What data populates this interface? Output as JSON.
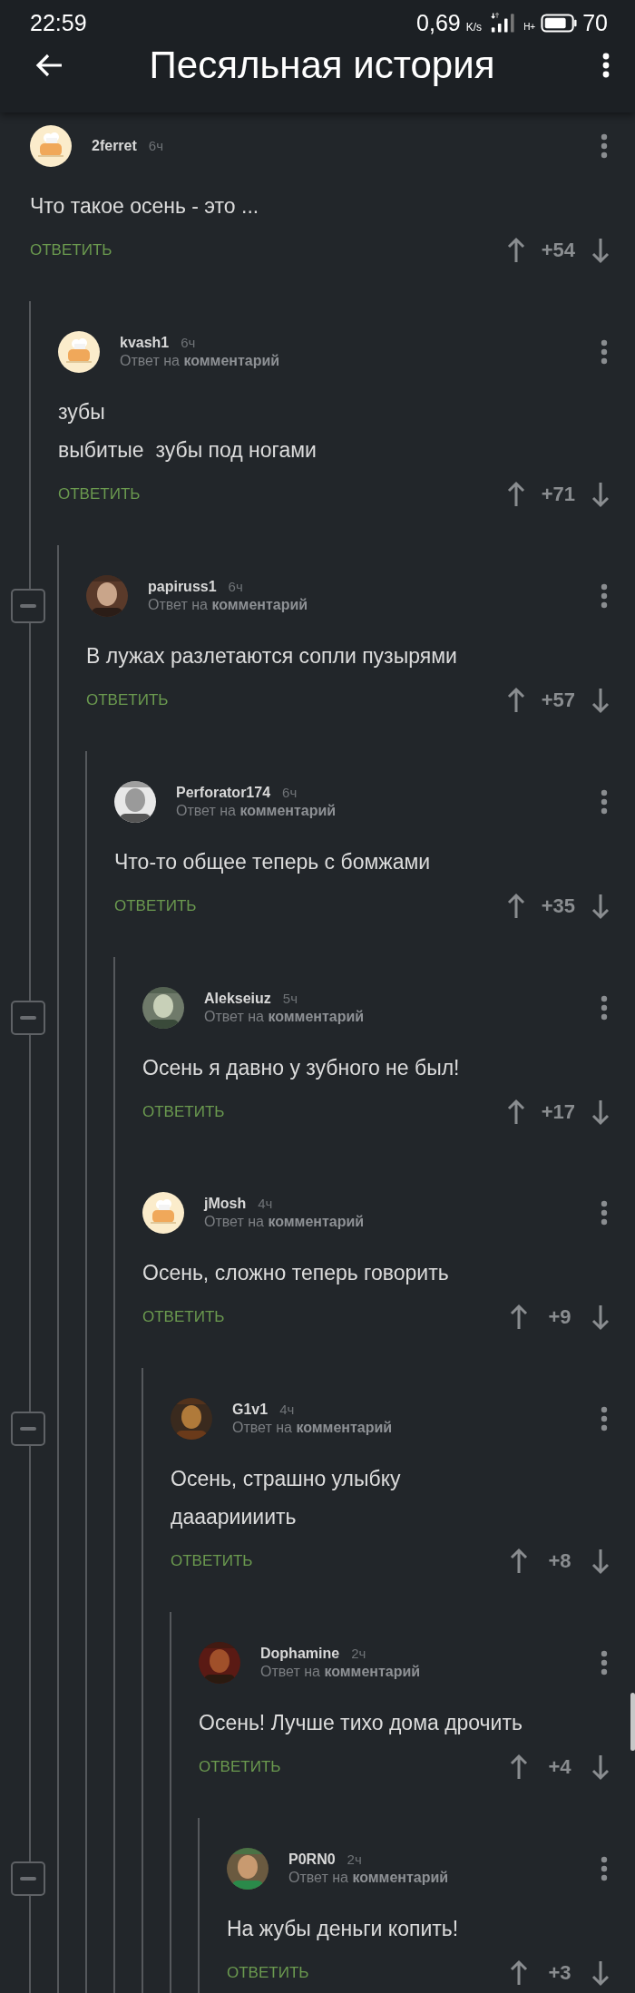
{
  "status_bar": {
    "time": "22:59",
    "speed": "0,69",
    "speed_unit": "K/s",
    "network": "H+",
    "battery": "70"
  },
  "app_bar": {
    "title": "Песяльная история"
  },
  "comments": [
    {
      "author": "2ferret",
      "time": "6ч",
      "avatar": {
        "kind": "default"
      },
      "text": "Что такое осень - это ...",
      "reply_label": "ОТВЕТИТЬ",
      "score": "+54",
      "children": [
        {
          "author": "kvash1",
          "time": "6ч",
          "avatar": {
            "kind": "default"
          },
          "reply_to": "Ответ на **комментарий**",
          "text": "зубы\nвыбитые  зубы под ногами",
          "reply_label": "ОТВЕТИТЬ",
          "score": "+71",
          "children": [
            {
              "author": "papiruss1",
              "time": "6ч",
              "avatar": {
                "kind": "picture"
              },
              "reply_to": "Ответ на **комментарий**",
              "collapse_button": true,
              "text": "В лужах разлетаются сопли пузырями",
              "reply_label": "ОТВЕТИТЬ",
              "score": "+57",
              "children": [
                {
                  "author": "Perforator174",
                  "time": "6ч",
                  "avatar": {
                    "kind": "picture"
                  },
                  "reply_to": "Ответ на **комментарий**",
                  "text": "Что-то общее теперь с бомжами",
                  "reply_label": "ОТВЕТИТЬ",
                  "score": "+35",
                  "children": [
                    {
                      "author": "Alekseiuz",
                      "time": "5ч",
                      "avatar": {
                        "kind": "picture"
                      },
                      "reply_to": "Ответ на **комментарий**",
                      "collapse_button": true,
                      "text": "Осень я давно у зубного не был!",
                      "reply_label": "ОТВЕТИТЬ",
                      "score": "+17"
                    },
                    {
                      "author": "jMosh",
                      "time": "4ч",
                      "avatar": {
                        "kind": "default"
                      },
                      "reply_to": "Ответ на **комментарий**",
                      "text": "Осень, сложно теперь говорить",
                      "reply_label": "ОТВЕТИТЬ",
                      "score": "+9",
                      "children": [
                        {
                          "author": "G1v1",
                          "time": "4ч",
                          "avatar": {
                            "kind": "picture"
                          },
                          "reply_to": "Ответ на **комментарий**",
                          "collapse_button": true,
                          "text": "Осень, страшно улыбку\nдааариииить",
                          "reply_label": "ОТВЕТИТЬ",
                          "score": "+8",
                          "children": [
                            {
                              "author": "Dophamine",
                              "time": "2ч",
                              "avatar": {
                                "kind": "picture"
                              },
                              "reply_to": "Ответ на **комментарий**",
                              "text": "Осень! Лучше тихо дома дрочить",
                              "reply_label": "ОТВЕТИТЬ",
                              "score": "+4",
                              "children": [
                                {
                                  "author": "P0RN0",
                                  "time": "2ч",
                                  "avatar": {
                                    "kind": "picture"
                                  },
                                  "reply_to": "Ответ на **комментарий**",
                                  "collapse_button": true,
                                  "text": "На жубы деньги копить!",
                                  "reply_label": "ОТВЕТИТЬ",
                                  "score": "+3"
                                }
                              ]
                            }
                          ]
                        }
                      ]
                    }
                  ]
                }
              ]
            }
          ]
        }
      ]
    }
  ]
}
